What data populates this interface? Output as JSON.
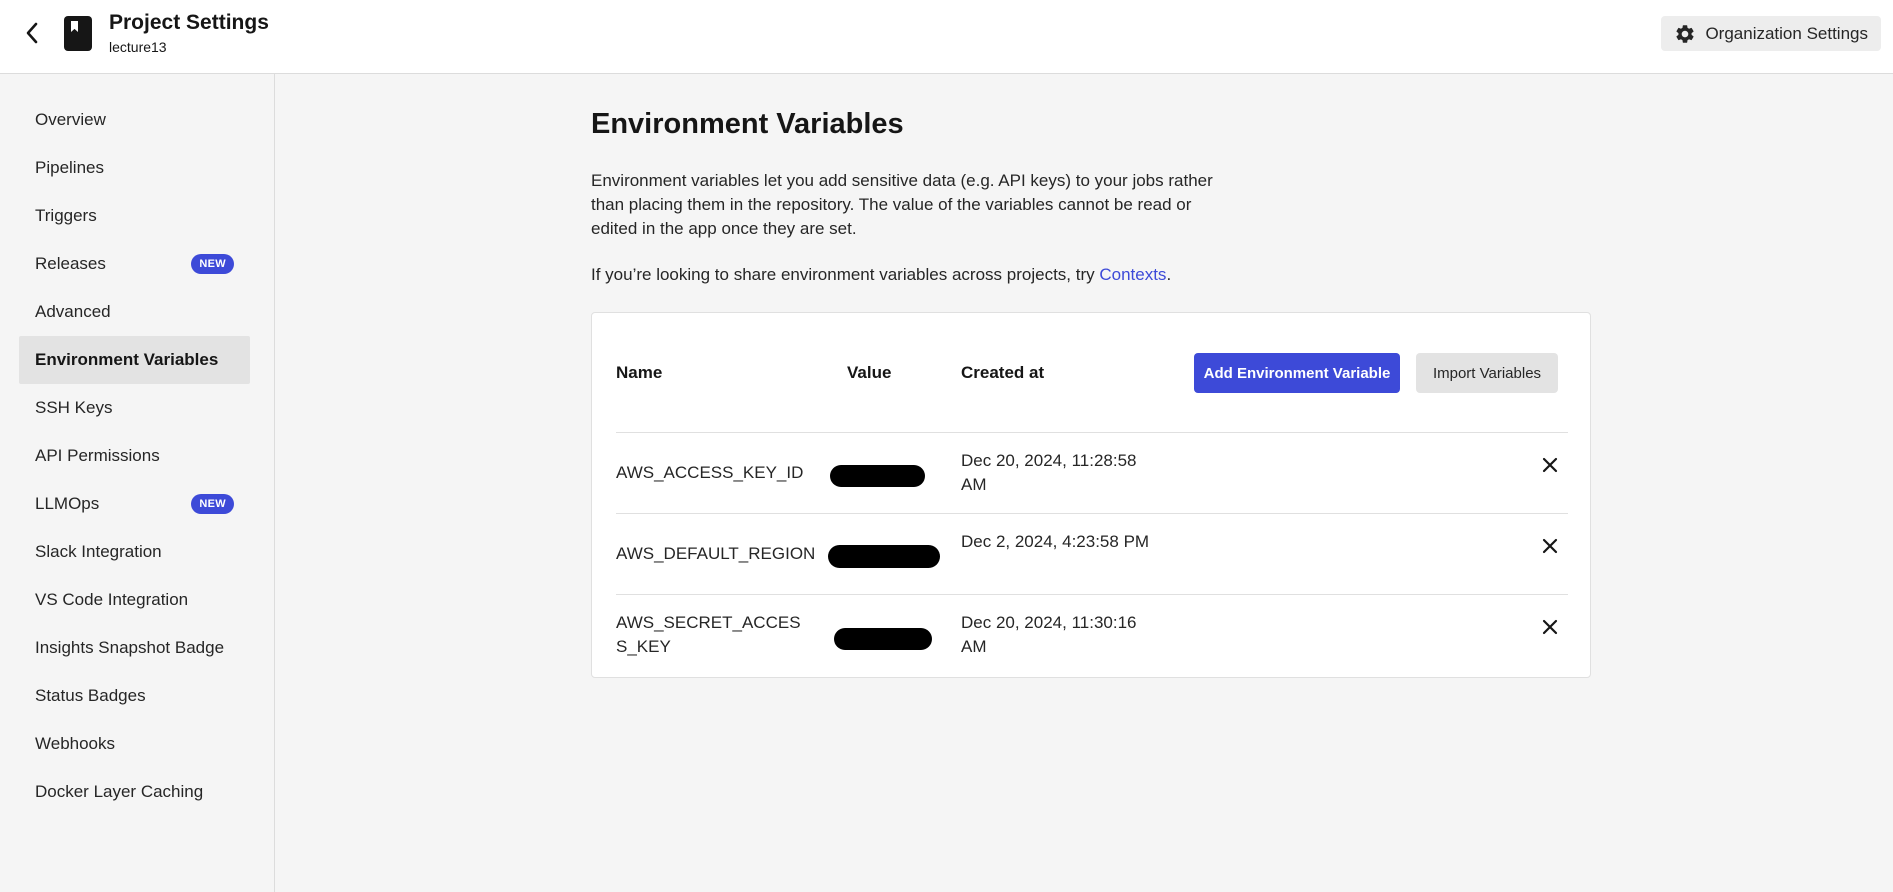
{
  "header": {
    "title": "Project Settings",
    "subtitle": "lecture13",
    "org_button": "Organization Settings"
  },
  "sidebar": {
    "items": [
      {
        "label": "Overview",
        "badge": ""
      },
      {
        "label": "Pipelines",
        "badge": ""
      },
      {
        "label": "Triggers",
        "badge": ""
      },
      {
        "label": "Releases",
        "badge": "NEW"
      },
      {
        "label": "Advanced",
        "badge": ""
      },
      {
        "label": "Environment Variables",
        "badge": "",
        "active": true
      },
      {
        "label": "SSH Keys",
        "badge": ""
      },
      {
        "label": "API Permissions",
        "badge": ""
      },
      {
        "label": "LLMOps",
        "badge": "NEW"
      },
      {
        "label": "Slack Integration",
        "badge": ""
      },
      {
        "label": "VS Code Integration",
        "badge": ""
      },
      {
        "label": "Insights Snapshot Badge",
        "badge": ""
      },
      {
        "label": "Status Badges",
        "badge": ""
      },
      {
        "label": "Webhooks",
        "badge": ""
      },
      {
        "label": "Docker Layer Caching",
        "badge": ""
      }
    ]
  },
  "main": {
    "title": "Environment Variables",
    "description": "Environment variables let you add sensitive data (e.g. API keys) to your jobs rather than placing them in the repository. The value of the variables cannot be read or edited in the app once they are set.",
    "contexts_prefix": "If you’re looking to share environment variables across projects, try ",
    "contexts_link": "Contexts",
    "contexts_suffix": ".",
    "table": {
      "col_name": "Name",
      "col_value": "Value",
      "col_created": "Created at",
      "add_button": "Add Environment Variable",
      "import_button": "Import Variables",
      "rows": [
        {
          "name": "AWS_ACCESS_KEY_ID",
          "created": "Dec 20, 2024, 11:28:58 AM"
        },
        {
          "name": "AWS_DEFAULT_REGION",
          "created": "Dec 2, 2024, 4:23:58 PM"
        },
        {
          "name": "AWS_SECRET_ACCESS_KEY",
          "created": "Dec 20, 2024, 11:30:16 AM"
        }
      ]
    }
  },
  "colors": {
    "accent": "#3d4ad8",
    "background": "#f5f5f5",
    "card": "#ffffff"
  }
}
